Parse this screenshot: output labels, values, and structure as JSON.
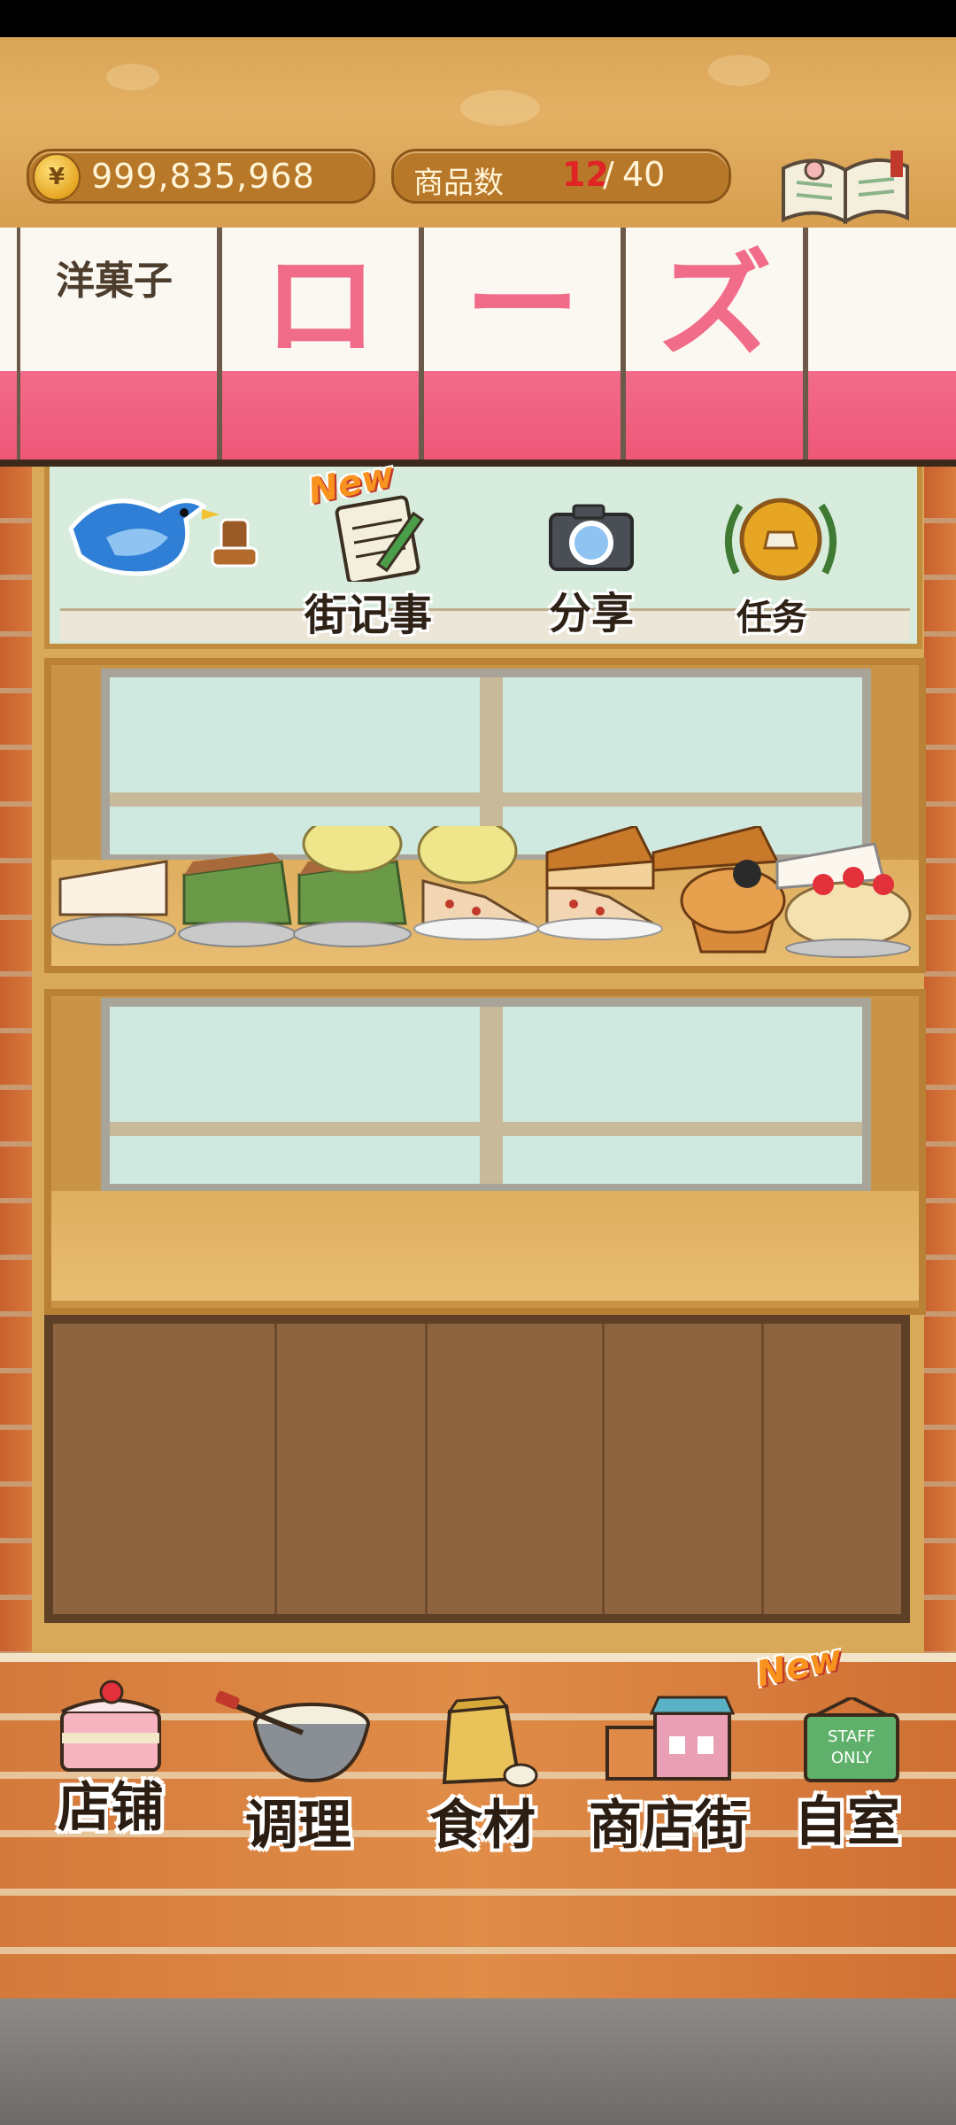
{
  "hud": {
    "coin_symbol": "¥",
    "coins": "999,835,968",
    "goods_label": "商品数",
    "goods_count": "12",
    "goods_sep": "/",
    "goods_max": "40"
  },
  "recipe": {
    "label": "食谱"
  },
  "sign": {
    "subtitle": "洋菓子",
    "chars": [
      "ロ",
      "ー",
      "ズ"
    ]
  },
  "shelf_actions": [
    {
      "label": "街记事",
      "badge": "New"
    },
    {
      "label": "分享"
    },
    {
      "label": "任务"
    }
  ],
  "nav": {
    "items": [
      {
        "label": "店铺"
      },
      {
        "label": "调理"
      },
      {
        "label": "食材"
      },
      {
        "label": "商店街"
      },
      {
        "label": "自室",
        "badge": "New"
      }
    ]
  },
  "colors": {
    "accent_pink": "#f06c89",
    "coin_red": "#e02424",
    "brick": "#d47a3c"
  }
}
